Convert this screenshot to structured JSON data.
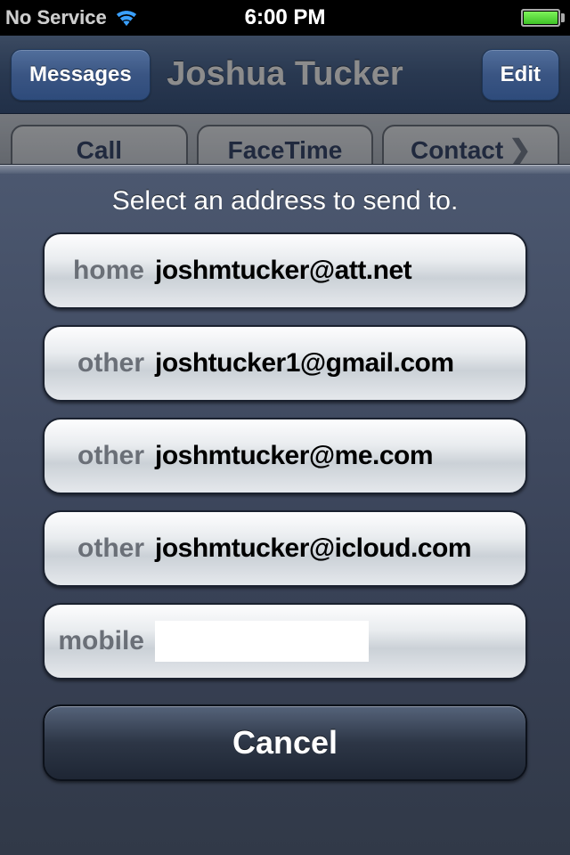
{
  "statusbar": {
    "carrier": "No Service",
    "time": "6:00 PM"
  },
  "navbar": {
    "back_label": "Messages",
    "title": "Joshua Tucker",
    "edit_label": "Edit"
  },
  "segments": {
    "call": "Call",
    "facetime": "FaceTime",
    "contact": "Contact"
  },
  "sheet": {
    "title": "Select an address to send to.",
    "options": [
      {
        "label": "home",
        "value": "joshmtucker@att.net"
      },
      {
        "label": "other",
        "value": "joshtucker1@gmail.com"
      },
      {
        "label": "other",
        "value": "joshmtucker@me.com"
      },
      {
        "label": "other",
        "value": "joshmtucker@icloud.com"
      },
      {
        "label": "mobile",
        "value": ""
      }
    ],
    "cancel": "Cancel"
  }
}
